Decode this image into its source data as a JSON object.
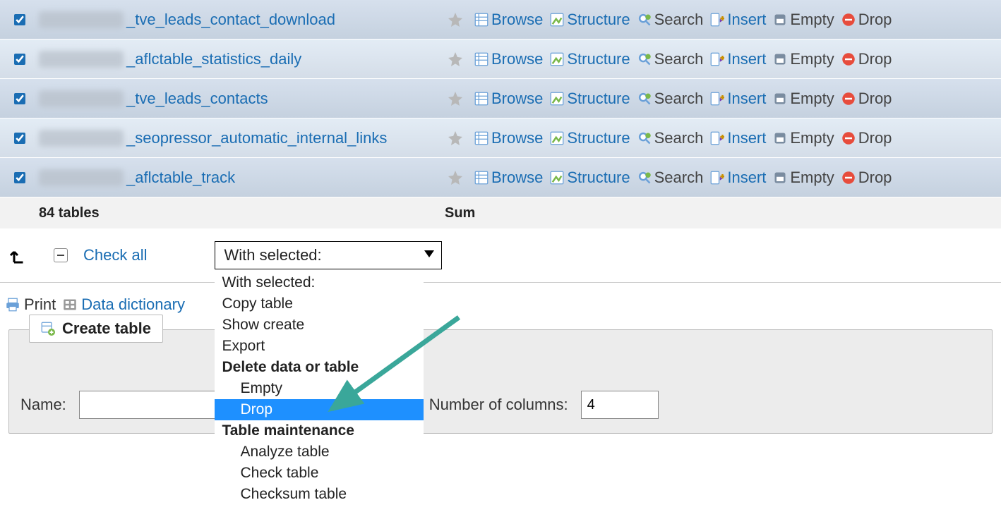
{
  "actions": {
    "browse": "Browse",
    "structure": "Structure",
    "search": "Search",
    "insert": "Insert",
    "empty": "Empty",
    "drop": "Drop"
  },
  "rows": [
    {
      "name": "_tve_leads_contact_download"
    },
    {
      "name": "_aflctable_statistics_daily"
    },
    {
      "name": "_tve_leads_contacts"
    },
    {
      "name": "_seopressor_automatic_internal_links"
    },
    {
      "name": "_aflctable_track"
    }
  ],
  "summary": {
    "tables": "84 tables",
    "sum": "Sum"
  },
  "controls": {
    "check_all": "Check all",
    "with_selected": "With selected:"
  },
  "dropdown": {
    "items": [
      {
        "label": "With selected:",
        "bold": false,
        "indent": false
      },
      {
        "label": "Copy table",
        "bold": false,
        "indent": false
      },
      {
        "label": "Show create",
        "bold": false,
        "indent": false
      },
      {
        "label": "Export",
        "bold": false,
        "indent": false
      },
      {
        "label": "Delete data or table",
        "bold": true,
        "indent": false
      },
      {
        "label": "Empty",
        "bold": false,
        "indent": true
      },
      {
        "label": "Drop",
        "bold": false,
        "indent": true,
        "selected": true
      },
      {
        "label": "Table maintenance",
        "bold": true,
        "indent": false
      },
      {
        "label": "Analyze table",
        "bold": false,
        "indent": true
      },
      {
        "label": "Check table",
        "bold": false,
        "indent": true
      },
      {
        "label": "Checksum table",
        "bold": false,
        "indent": true
      }
    ]
  },
  "links": {
    "print": "Print",
    "data_dictionary": "Data dictionary"
  },
  "create": {
    "legend": "Create table",
    "name_label": "Name:",
    "cols_label": "Number of columns:",
    "cols_value": "4"
  }
}
